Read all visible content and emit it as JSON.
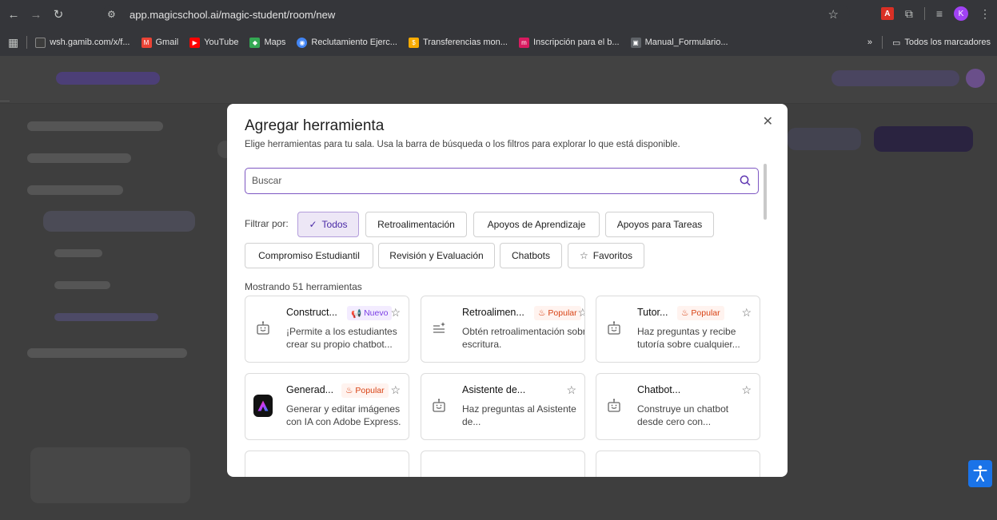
{
  "browser": {
    "url": "app.magicschool.ai/magic-student/room/new",
    "profile_initial": "K",
    "bookmarks": [
      {
        "label": "wsh.gamib.com/x/f...",
        "color": "#3c3c3c"
      },
      {
        "label": "Gmail",
        "color": "#ea4335"
      },
      {
        "label": "YouTube",
        "color": "#ff0000"
      },
      {
        "label": "Maps",
        "color": "#34a853"
      },
      {
        "label": "Reclutamiento Ejerc...",
        "color": "#4285f4"
      },
      {
        "label": "Transferencias mon...",
        "color": "#f9ab00"
      },
      {
        "label": "Inscripción para el b...",
        "color": "#d81b60"
      },
      {
        "label": "Manual_Formulario...",
        "color": "#5f6368"
      }
    ],
    "all_bookmarks_label": "Todos los marcadores"
  },
  "modal": {
    "title": "Agregar herramienta",
    "subtitle": "Elige herramientas para tu sala. Usa la barra de búsqueda o los filtros para explorar lo que está disponible.",
    "search_placeholder": "Buscar",
    "filter_label": "Filtrar por:",
    "filters": [
      {
        "label": "Todos",
        "active": true
      },
      {
        "label": "Retroalimentación",
        "active": false
      },
      {
        "label": "Apoyos de Aprendizaje",
        "active": false
      },
      {
        "label": "Apoyos para Tareas",
        "active": false
      },
      {
        "label": "Compromiso Estudiantil",
        "active": false
      },
      {
        "label": "Revisión y Evaluación",
        "active": false
      },
      {
        "label": "Chatbots",
        "active": false
      },
      {
        "label": "Favoritos",
        "active": false
      }
    ],
    "count_text": "Mostrando 51 herramientas",
    "tools": [
      {
        "title": "Construct...",
        "badge": "Nuevo",
        "badge_type": "new",
        "desc": "¡Permite a los estudiantes crear su propio chatbot...",
        "icon": "robot-icon"
      },
      {
        "title": "Retroalimen...",
        "badge": "Popular",
        "badge_type": "popular",
        "desc": "Obtén retroalimentación sobre tu escritura.",
        "icon": "document-sparkle-icon"
      },
      {
        "title": "Tutor...",
        "badge": "Popular",
        "badge_type": "popular",
        "desc": "Haz preguntas y recibe tutoría sobre cualquier...",
        "icon": "robot-icon"
      },
      {
        "title": "Generad...",
        "badge": "Popular",
        "badge_type": "popular",
        "desc": "Generar y editar imágenes con IA con Adobe Express.",
        "icon": "adobe-express-icon"
      },
      {
        "title": "Asistente de...",
        "badge": "",
        "badge_type": "",
        "desc": "Haz preguntas al Asistente de...",
        "icon": "robot-icon"
      },
      {
        "title": "Chatbot...",
        "badge": "",
        "badge_type": "",
        "desc": "Construye un chatbot desde cero con...",
        "icon": "robot-icon"
      }
    ]
  },
  "colors": {
    "accent": "#7e57c2",
    "popular": "#d84315",
    "new": "#7b3fe4",
    "a11y": "#1a73e8"
  }
}
